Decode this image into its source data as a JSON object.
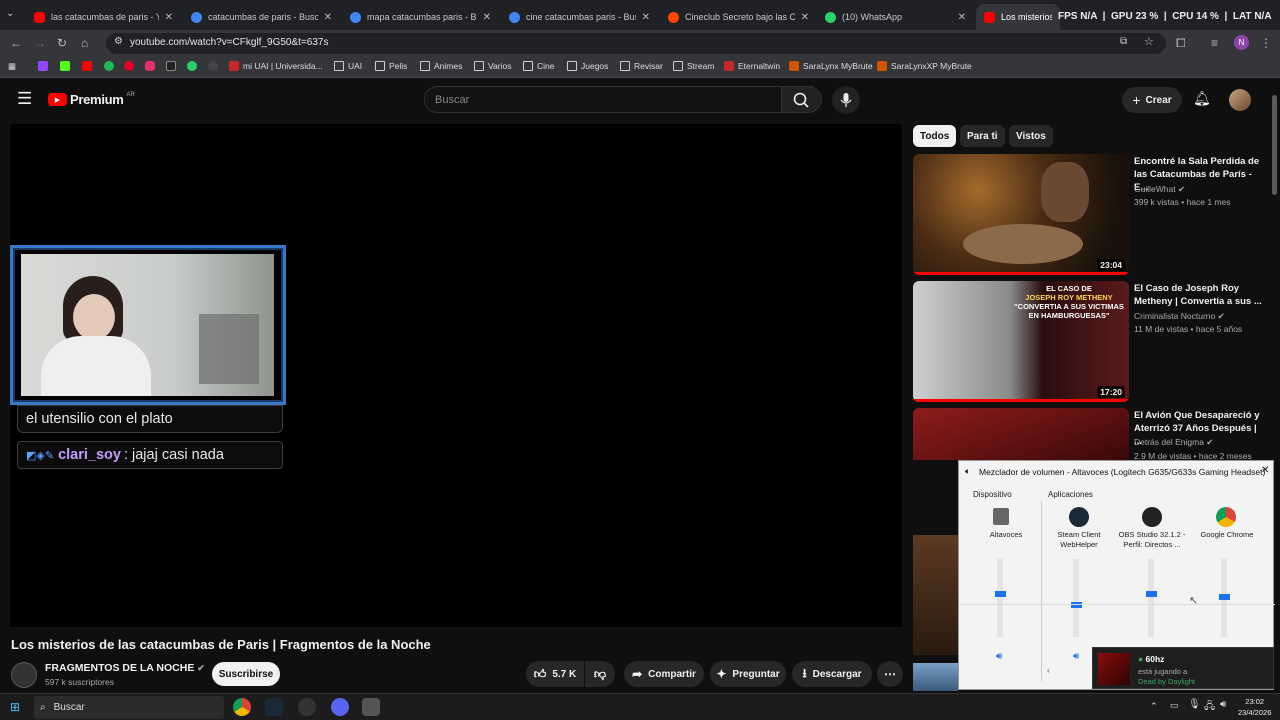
{
  "browser": {
    "tabs": [
      {
        "label": "las catacumbas de paris - YouTube",
        "color": "#ff0000"
      },
      {
        "label": "catacumbas de paris - Buscar con Google",
        "color": "#4285f4"
      },
      {
        "label": "mapa catacumbas paris - Buscar con Google",
        "color": "#4285f4"
      },
      {
        "label": "cine catacumbas paris - Buscar con Google",
        "color": "#4285f4"
      },
      {
        "label": "Cineclub Secreto bajo las Catacumbas",
        "color": "#ff4500"
      },
      {
        "label": "(10) WhatsApp",
        "color": "#25d366"
      },
      {
        "label": "Los misterios de las catacumbas",
        "color": "#ff0000"
      }
    ],
    "url": "youtube.com/watch?v=CFkglf_9G50&t=637s",
    "bookmarks": [
      "mi UAI | Universida...",
      "UAI",
      "Pelis",
      "Animes",
      "Varios",
      "Cine",
      "Juegos",
      "Revisar",
      "Stream",
      "Eternaltwin",
      "SaraLynx MyBrute",
      "SaraLynxXP MyBrute"
    ],
    "profile_letter": "N"
  },
  "overlay": {
    "fps_label": "FPS",
    "fps_value": "N/A",
    "gpu_label": "GPU",
    "gpu_value": "23",
    "gpu_unit": "%",
    "cpu_label": "CPU",
    "cpu_value": "14",
    "cpu_unit": "%",
    "lat_label": "LAT",
    "lat_value": "N/A"
  },
  "youtube": {
    "logo_text": "Premium",
    "region": "AR",
    "search_placeholder": "Buscar",
    "create_label": "Crear",
    "chat_lines": [
      "el utensilio con el plato"
    ],
    "chat_user": "clari_soy",
    "chat_msg": ": jajaj casi nada",
    "video_title": "Los misterios de las catacumbas de Paris | Fragmentos de la Noche",
    "channel_name": "FRAGMENTOS DE LA NOCHE",
    "subscribers": "597 k suscriptores",
    "subscribe_label": "Suscribirse",
    "likes": "5.7 K",
    "share_label": "Compartir",
    "ask_label": "Preguntar",
    "download_label": "Descargar",
    "chips": [
      "Todos",
      "Para ti",
      "Vistos"
    ],
    "recommended": [
      {
        "title": "Encontré la Sala Perdida de las Catacumbas de París - E...",
        "channel": "GuilleWhat",
        "meta": "399 k vistas • hace 1 mes",
        "duration": "23:04",
        "progress": 1.0
      },
      {
        "title": "El Caso de Joseph Roy Metheny | Convertía a sus ...",
        "channel": "Criminalista Nocturno",
        "meta": "11 M de vistas • hace 5 años",
        "duration": "17:20",
        "progress": 1.0,
        "thumb_text_1": "EL CASO DE",
        "thumb_text_2": "JOSEPH ROY METHENY",
        "thumb_text_3": "\"CONVERTIA A SUS VICTIMAS EN HAMBURGUESAS\""
      },
      {
        "title": "El Avión Que Desapareció y Aterrizó 37 Años Después | ...",
        "channel": "Detrás del Enigma",
        "meta": "2.9 M de vistas • hace 2 meses",
        "duration": "",
        "progress": 0
      }
    ]
  },
  "mixer": {
    "title": "Mezclador de volumen - Altavoces (Logitech G635/G633s Gaming Headset)",
    "device_label": "Dispositivo",
    "apps_label": "Aplicaciones",
    "channels": [
      {
        "name": "Altavoces",
        "level": 0.55
      },
      {
        "name": "Steam Client WebHelper",
        "level": 0.4
      },
      {
        "name": "OBS Studio 32.1.2 - Perfil: Directos ...",
        "level": 0.55
      },
      {
        "name": "Google Chrome",
        "level": 0.52
      }
    ]
  },
  "notification": {
    "user": "60hz",
    "line1": "está jugando a",
    "game": "Dead by Daylight"
  },
  "taskbar": {
    "search_placeholder": "Buscar",
    "time": "23:02",
    "date": "23/4/2026"
  }
}
